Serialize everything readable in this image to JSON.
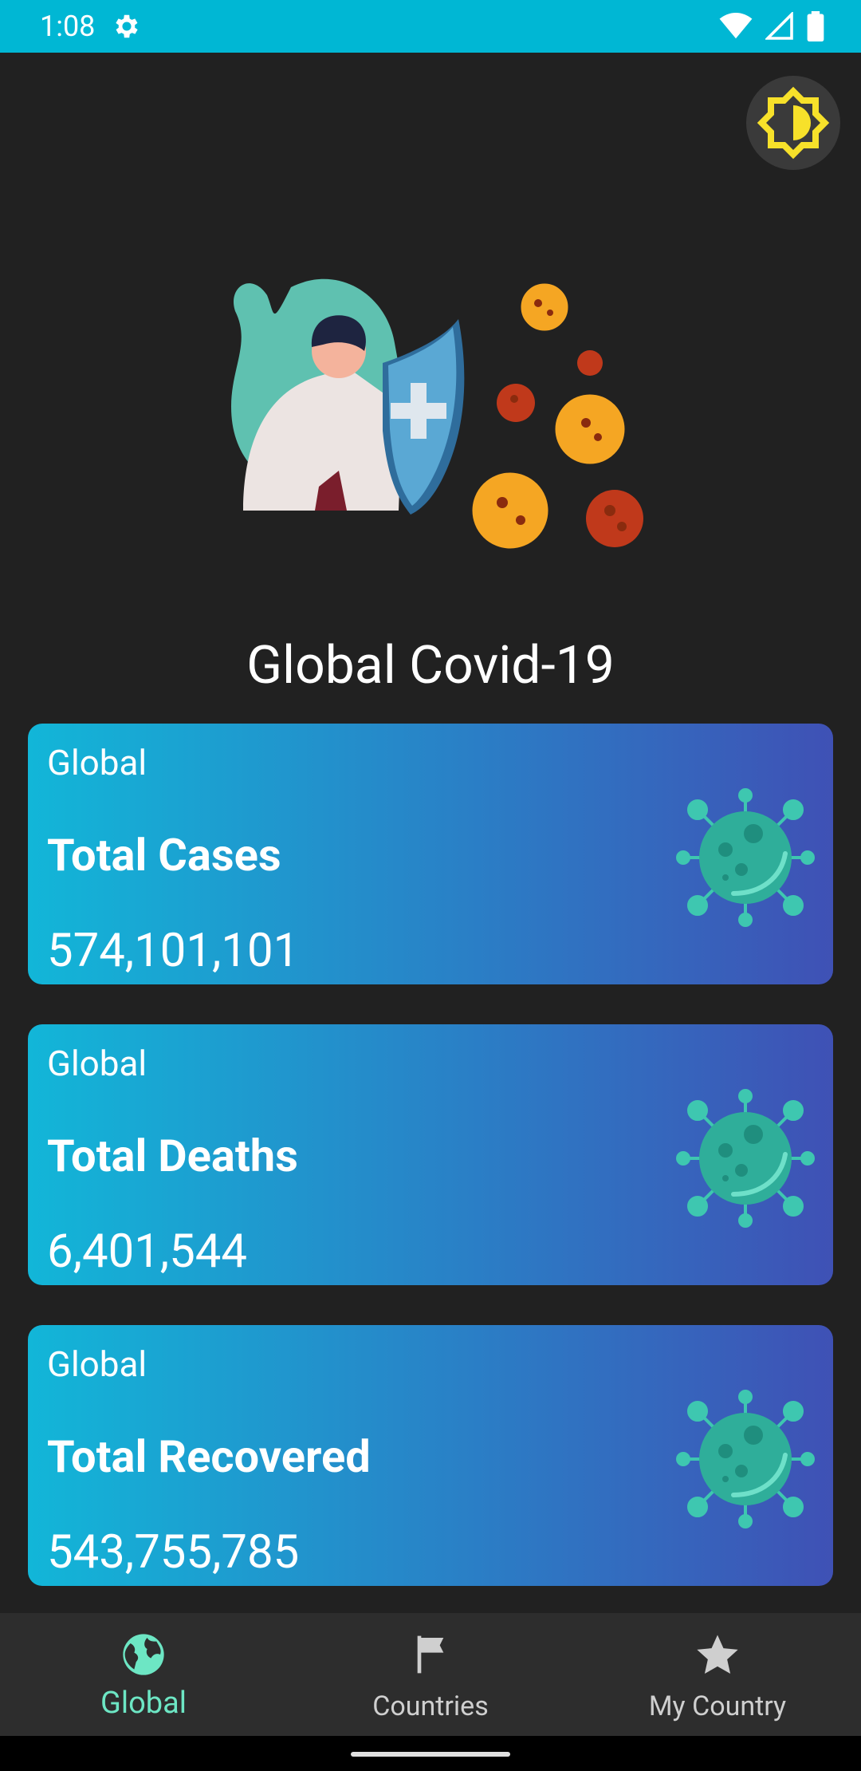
{
  "status_bar": {
    "time": "1:08",
    "icons": [
      "settings-gear-icon",
      "wifi-icon",
      "signal-icon",
      "battery-icon"
    ],
    "color": "#00b7d4"
  },
  "theme_toggle": {
    "icon": "brightness-icon",
    "color": "#f7e12a"
  },
  "hero": {
    "illustration": "person-with-shield-vs-virus"
  },
  "page_title": "Global Covid-19",
  "cards": [
    {
      "label": "Global",
      "title": "Total Cases",
      "value": "574,101,101",
      "icon": "virus-icon"
    },
    {
      "label": "Global",
      "title": "Total Deaths",
      "value": "6,401,544",
      "icon": "virus-icon"
    },
    {
      "label": "Global",
      "title": "Total Recovered",
      "value": "543,755,785",
      "icon": "virus-icon"
    }
  ],
  "bottom_nav": {
    "items": [
      {
        "label": "Global",
        "icon": "globe-icon",
        "active": true
      },
      {
        "label": "Countries",
        "icon": "flag-icon",
        "active": false
      },
      {
        "label": "My Country",
        "icon": "star-icon",
        "active": false
      }
    ],
    "active_color": "#6de6c4"
  }
}
